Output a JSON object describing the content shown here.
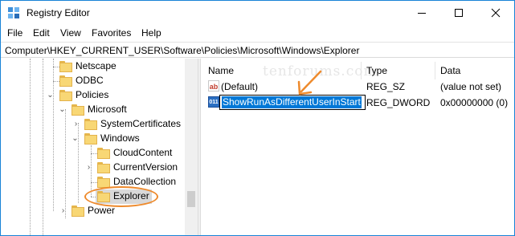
{
  "window": {
    "title": "Registry Editor",
    "icon": "registry-editor-icon",
    "accent_color": "#1883d7"
  },
  "menu": {
    "items": [
      "File",
      "Edit",
      "View",
      "Favorites",
      "Help"
    ]
  },
  "address": {
    "path": "Computer\\HKEY_CURRENT_USER\\Software\\Policies\\Microsoft\\Windows\\Explorer"
  },
  "tree": {
    "items": [
      {
        "label": "Netscape",
        "expander": "",
        "icon": "folder-icon"
      },
      {
        "label": "ODBC",
        "expander": "",
        "icon": "folder-icon"
      },
      {
        "label": "Policies",
        "expander": "expanded",
        "icon": "folder-icon"
      },
      {
        "label": "Microsoft",
        "expander": "expanded",
        "icon": "folder-icon"
      },
      {
        "label": "SystemCertificates",
        "expander": "collapsed",
        "icon": "folder-icon"
      },
      {
        "label": "Windows",
        "expander": "expanded",
        "icon": "folder-icon"
      },
      {
        "label": "CloudContent",
        "expander": "",
        "icon": "folder-icon"
      },
      {
        "label": "CurrentVersion",
        "expander": "collapsed",
        "icon": "folder-icon"
      },
      {
        "label": "DataCollection",
        "expander": "",
        "icon": "folder-icon"
      },
      {
        "label": "Explorer",
        "expander": "",
        "icon": "folder-icon",
        "selected": true
      },
      {
        "label": "Power",
        "expander": "collapsed",
        "icon": "folder-icon"
      }
    ]
  },
  "list": {
    "columns": [
      "Name",
      "Type",
      "Data"
    ],
    "rows": [
      {
        "name": "(Default)",
        "type": "REG_SZ",
        "data": "(value not set)",
        "icon": "reg-sz-icon"
      },
      {
        "name": "ShowRunAsDifferentUserInStart",
        "type": "REG_DWORD",
        "data": "0x00000000 (0)",
        "icon": "reg-dword-icon",
        "editing": true
      }
    ]
  },
  "watermark": "tenforums.com",
  "annotation": {
    "color": "#ee8a2c"
  }
}
